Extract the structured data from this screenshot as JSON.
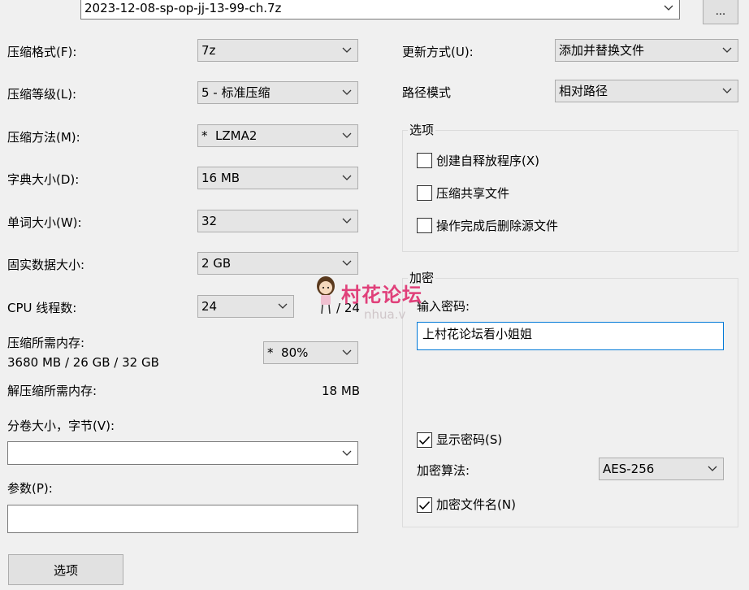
{
  "archive": {
    "path": "2023-12-08-sp-op-jj-13-99-ch.7z",
    "browse_label": "..."
  },
  "left": {
    "format_label": "压缩格式(F):",
    "format_value": "7z",
    "level_label": "压缩等级(L):",
    "level_value": "5 - 标准压缩",
    "method_label": "压缩方法(M):",
    "method_value": "*  LZMA2",
    "dict_label": "字典大小(D):",
    "dict_value": "16 MB",
    "word_label": "单词大小(W):",
    "word_value": "32",
    "solid_label": "固实数据大小:",
    "solid_value": "2 GB",
    "cpu_label": "CPU 线程数:",
    "cpu_value": "24",
    "cpu_total": "/ 24",
    "mem_label": "压缩所需内存:",
    "mem_value": "3680 MB / 26 GB / 32 GB",
    "mem_percent": "*  80%",
    "decomp_label": "解压缩所需内存:",
    "decomp_value": "18 MB",
    "volume_label": "分卷大小，字节(V):",
    "volume_value": "",
    "params_label": "参数(P):",
    "params_value": "",
    "options_button": "选项"
  },
  "right": {
    "update_label": "更新方式(U):",
    "update_value": "添加并替换文件",
    "path_label": "路径模式",
    "path_value": "相对路径",
    "options_group": "选项",
    "opt_sfx": "创建自释放程序(X)",
    "opt_shared": "压缩共享文件",
    "opt_delete": "操作完成后删除源文件",
    "encryption_group": "加密",
    "password_label": "输入密码:",
    "password_value": "上村花论坛看小姐姐",
    "show_password": "显示密码(S)",
    "method_label": "加密算法:",
    "method_value": "AES-256",
    "encrypt_names": "加密文件名(N)"
  },
  "checkboxes": {
    "sfx": false,
    "shared": false,
    "delete": false,
    "show_password": true,
    "encrypt_names": true
  },
  "watermark": {
    "text": "村花论坛",
    "sub": "nhua.v"
  },
  "colors": {
    "accent": "#0078d7",
    "watermark": "#e0407a"
  }
}
